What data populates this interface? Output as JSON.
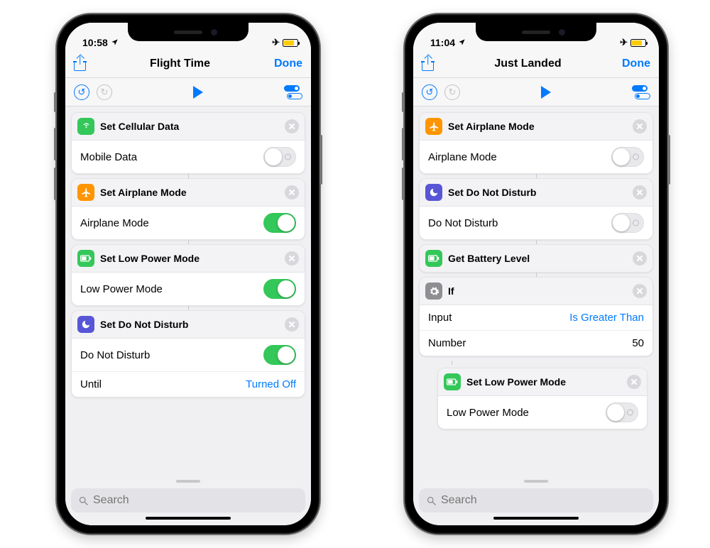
{
  "left": {
    "status": {
      "time": "10:58"
    },
    "nav": {
      "title": "Flight Time",
      "done": "Done"
    },
    "search_placeholder": "Search",
    "actions": [
      {
        "icon": "cellular",
        "icon_color": "ic-green",
        "title": "Set Cellular Data",
        "rows": [
          {
            "label": "Mobile Data",
            "toggle": false
          }
        ]
      },
      {
        "icon": "airplane",
        "icon_color": "ic-orange",
        "title": "Set Airplane Mode",
        "rows": [
          {
            "label": "Airplane Mode",
            "toggle": true
          }
        ]
      },
      {
        "icon": "battery",
        "icon_color": "ic-green",
        "title": "Set Low Power Mode",
        "rows": [
          {
            "label": "Low Power Mode",
            "toggle": true
          }
        ]
      },
      {
        "icon": "moon",
        "icon_color": "ic-purple",
        "title": "Set Do Not Disturb",
        "rows": [
          {
            "label": "Do Not Disturb",
            "toggle": true
          },
          {
            "label": "Until",
            "value_link": "Turned Off"
          }
        ]
      }
    ]
  },
  "right": {
    "status": {
      "time": "11:04"
    },
    "nav": {
      "title": "Just Landed",
      "done": "Done"
    },
    "search_placeholder": "Search",
    "actions": [
      {
        "icon": "airplane",
        "icon_color": "ic-orange",
        "title": "Set Airplane Mode",
        "rows": [
          {
            "label": "Airplane Mode",
            "toggle": false
          }
        ]
      },
      {
        "icon": "moon",
        "icon_color": "ic-purple",
        "title": "Set Do Not Disturb",
        "rows": [
          {
            "label": "Do Not Disturb",
            "toggle": false
          }
        ]
      },
      {
        "icon": "battery",
        "icon_color": "ic-green",
        "title": "Get Battery Level",
        "rows": []
      },
      {
        "icon": "gear",
        "icon_color": "ic-gray",
        "title": "If",
        "rows": [
          {
            "label": "Input",
            "value_link": "Is Greater Than"
          },
          {
            "label": "Number",
            "value": "50"
          }
        ],
        "nested": {
          "icon": "battery",
          "icon_color": "ic-green",
          "title": "Set Low Power Mode",
          "rows": [
            {
              "label": "Low Power Mode",
              "toggle": false
            }
          ]
        }
      }
    ]
  }
}
